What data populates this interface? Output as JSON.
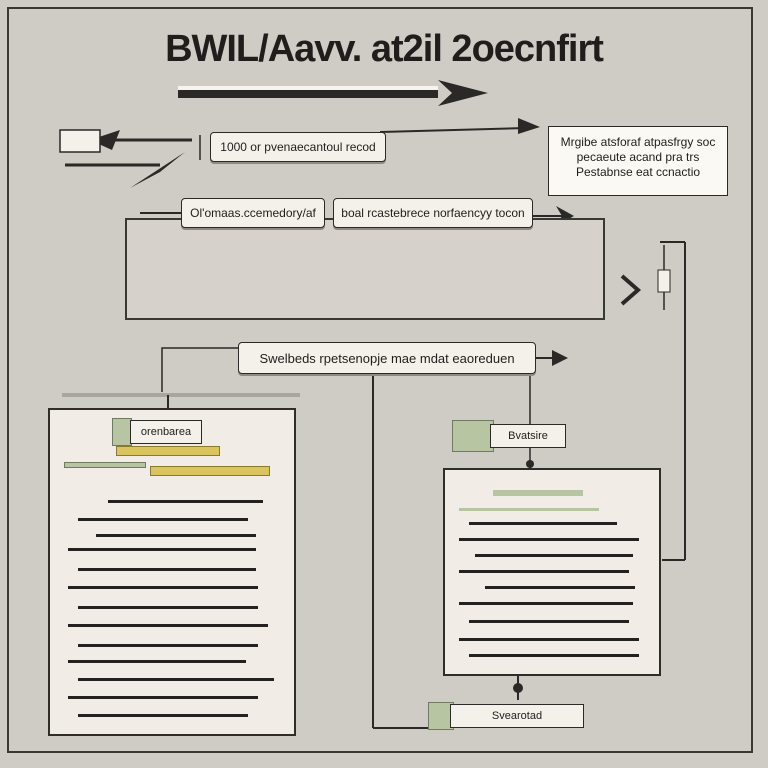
{
  "title": "BWIL/Aavv. at2il 2oecnfirt",
  "labels": {
    "top_chip": "1000 or pvenaecantoul recod",
    "note_text": "Mrgibe atsforaf atpasfrgy soc pecaeute acand pra trs Pestabnse eat ccnactio",
    "left_chip": "Ol'omaas.ccemedory/af",
    "right_chip": "boal rcastebrece norfaencyy tocon",
    "center_banner": "Swelbeds rpetsenopje mae mdat eaoreduen",
    "left_doc_tag": "orenbarea",
    "right_doc_tag": "Bvatsire",
    "bottom_chip": "Svearotad"
  },
  "colors": {
    "background": "#cfcbc5",
    "ink": "#1f1e1c",
    "paper": "#f1ede6",
    "accent_green": "#b8c5a2",
    "accent_yellow": "#d9c45e"
  }
}
